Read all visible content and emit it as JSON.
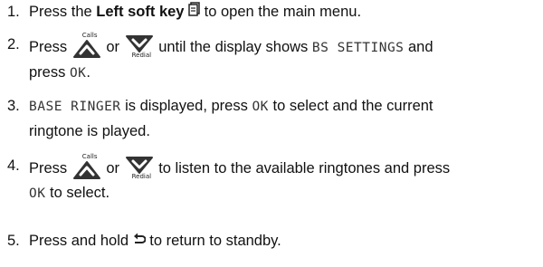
{
  "icons": {
    "softkey": "menu-softkey-icon",
    "up": "up-arrow-calls-icon",
    "down": "down-arrow-redial-icon",
    "back": "back-arrow-icon",
    "up_caption": "Calls",
    "down_caption": "Redial"
  },
  "steps": [
    {
      "num": "1.",
      "a": "Press the ",
      "b": "Left soft key",
      "c": " to open the main menu."
    },
    {
      "num": "2.",
      "a": "Press ",
      "or": " or ",
      "b": " until the display shows ",
      "lcd1": "BS SETTINGS",
      "c": " and",
      "d": "press ",
      "lcd2": "OK",
      "e": "."
    },
    {
      "num": "3.",
      "lcd1": "BASE RINGER",
      "a": " is displayed, press ",
      "lcd2": "OK",
      "b": " to select and the current",
      "c": "ringtone is played."
    },
    {
      "num": "4.",
      "a": "Press ",
      "or": " or ",
      "b": " to listen to the available ringtones and press",
      "lcd1": "OK",
      "c": " to select."
    },
    {
      "num": "5.",
      "a": "Press and hold ",
      "b": " to return to standby."
    }
  ]
}
